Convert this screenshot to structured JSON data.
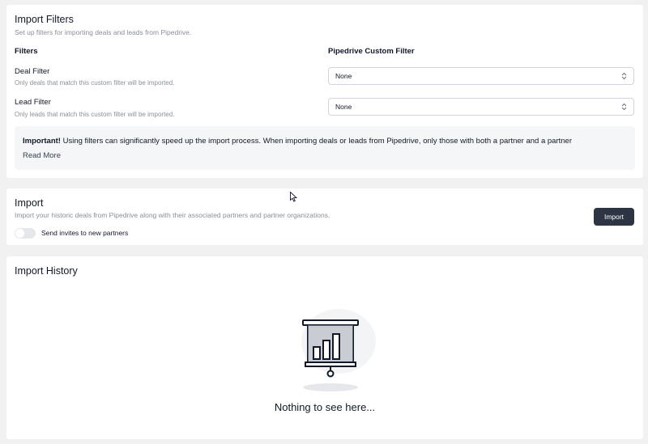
{
  "filters_card": {
    "title": "Import Filters",
    "subtitle": "Set up filters for importing deals and leads from Pipedrive.",
    "col_filters": "Filters",
    "col_custom_filter": "Pipedrive Custom Filter",
    "deal_filter": {
      "label": "Deal Filter",
      "help": "Only deals that match this custom filter will be imported.",
      "value": "None"
    },
    "lead_filter": {
      "label": "Lead Filter",
      "help": "Only leads that match this custom filter will be imported.",
      "value": "None"
    },
    "notice": {
      "strong": "Important!",
      "text": " Using filters can significantly speed up the import process. When importing deals or leads from Pipedrive, only those with both a partner and a partner",
      "read_more": "Read More"
    }
  },
  "import_card": {
    "title": "Import",
    "subtitle": "Import your historic deals from Pipedrive along with their associated partners and partner organizations.",
    "toggle_label": "Send invites to new partners",
    "toggle_on": false,
    "button_label": "Import"
  },
  "history_card": {
    "title": "Import History",
    "empty_text": "Nothing to see here..."
  },
  "colors": {
    "page_bg": "#f1f1f2",
    "card_bg": "#ffffff",
    "button_bg": "#2d3443",
    "muted_text": "#8a8f98"
  }
}
